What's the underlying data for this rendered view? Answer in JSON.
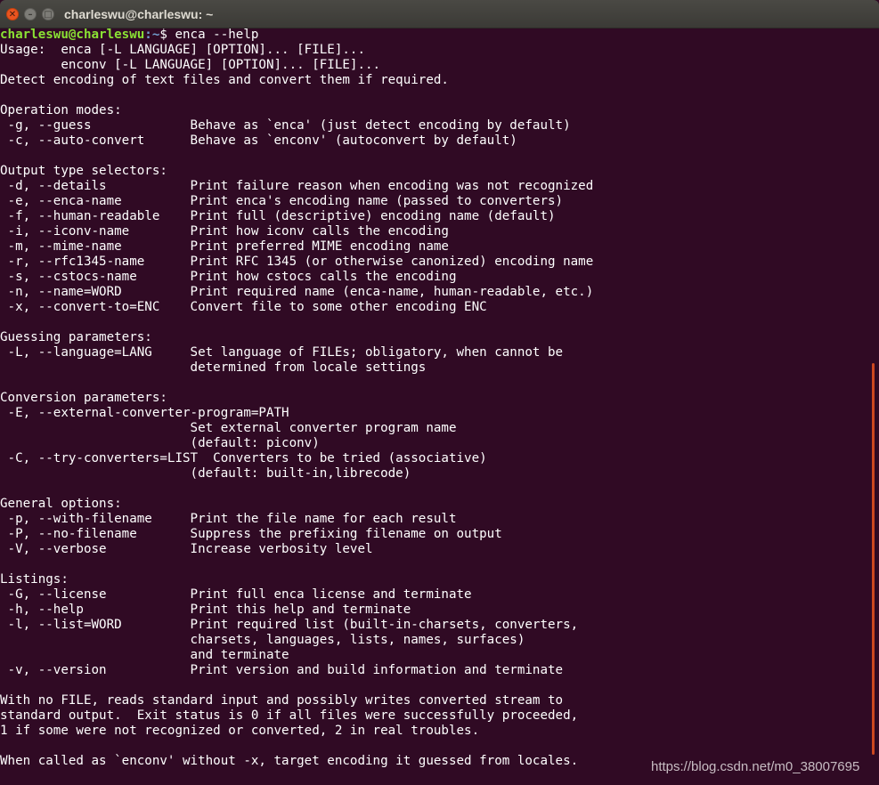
{
  "window": {
    "title": "charleswu@charleswu: ~",
    "close_glyph": "✕",
    "minimize_glyph": "–",
    "maximize_glyph": "□"
  },
  "colors": {
    "terminal_background": "#300a24",
    "prompt_user": "#8ae234",
    "prompt_path": "#729fcf",
    "text": "#ffffff",
    "close_button": "#e95420"
  },
  "prompt": {
    "user_host": "charleswu@charleswu",
    "path": ":~",
    "command": "$ enca --help"
  },
  "output_lines": [
    "Usage:  enca [-L LANGUAGE] [OPTION]... [FILE]...",
    "        enconv [-L LANGUAGE] [OPTION]... [FILE]...",
    "Detect encoding of text files and convert them if required.",
    "",
    "Operation modes:",
    " -g, --guess             Behave as `enca' (just detect encoding by default)",
    " -c, --auto-convert      Behave as `enconv' (autoconvert by default)",
    "",
    "Output type selectors:",
    " -d, --details           Print failure reason when encoding was not recognized",
    " -e, --enca-name         Print enca's encoding name (passed to converters)",
    " -f, --human-readable    Print full (descriptive) encoding name (default)",
    " -i, --iconv-name        Print how iconv calls the encoding",
    " -m, --mime-name         Print preferred MIME encoding name",
    " -r, --rfc1345-name      Print RFC 1345 (or otherwise canonized) encoding name",
    " -s, --cstocs-name       Print how cstocs calls the encoding",
    " -n, --name=WORD         Print required name (enca-name, human-readable, etc.)",
    " -x, --convert-to=ENC    Convert file to some other encoding ENC",
    "",
    "Guessing parameters:",
    " -L, --language=LANG     Set language of FILEs; obligatory, when cannot be",
    "                         determined from locale settings",
    "",
    "Conversion parameters:",
    " -E, --external-converter-program=PATH",
    "                         Set external converter program name",
    "                         (default: piconv)",
    " -C, --try-converters=LIST  Converters to be tried (associative)",
    "                         (default: built-in,librecode)",
    "",
    "General options:",
    " -p, --with-filename     Print the file name for each result",
    " -P, --no-filename       Suppress the prefixing filename on output",
    " -V, --verbose           Increase verbosity level",
    "",
    "Listings:",
    " -G, --license           Print full enca license and terminate",
    " -h, --help              Print this help and terminate",
    " -l, --list=WORD         Print required list (built-in-charsets, converters,",
    "                         charsets, languages, lists, names, surfaces)",
    "                         and terminate",
    " -v, --version           Print version and build information and terminate",
    "",
    "With no FILE, reads standard input and possibly writes converted stream to",
    "standard output.  Exit status is 0 if all files were successfully proceeded,",
    "1 if some were not recognized or converted, 2 in real troubles.",
    "",
    "When called as `enconv' without -x, target encoding it guessed from locales."
  ],
  "watermark": "https://blog.csdn.net/m0_38007695"
}
